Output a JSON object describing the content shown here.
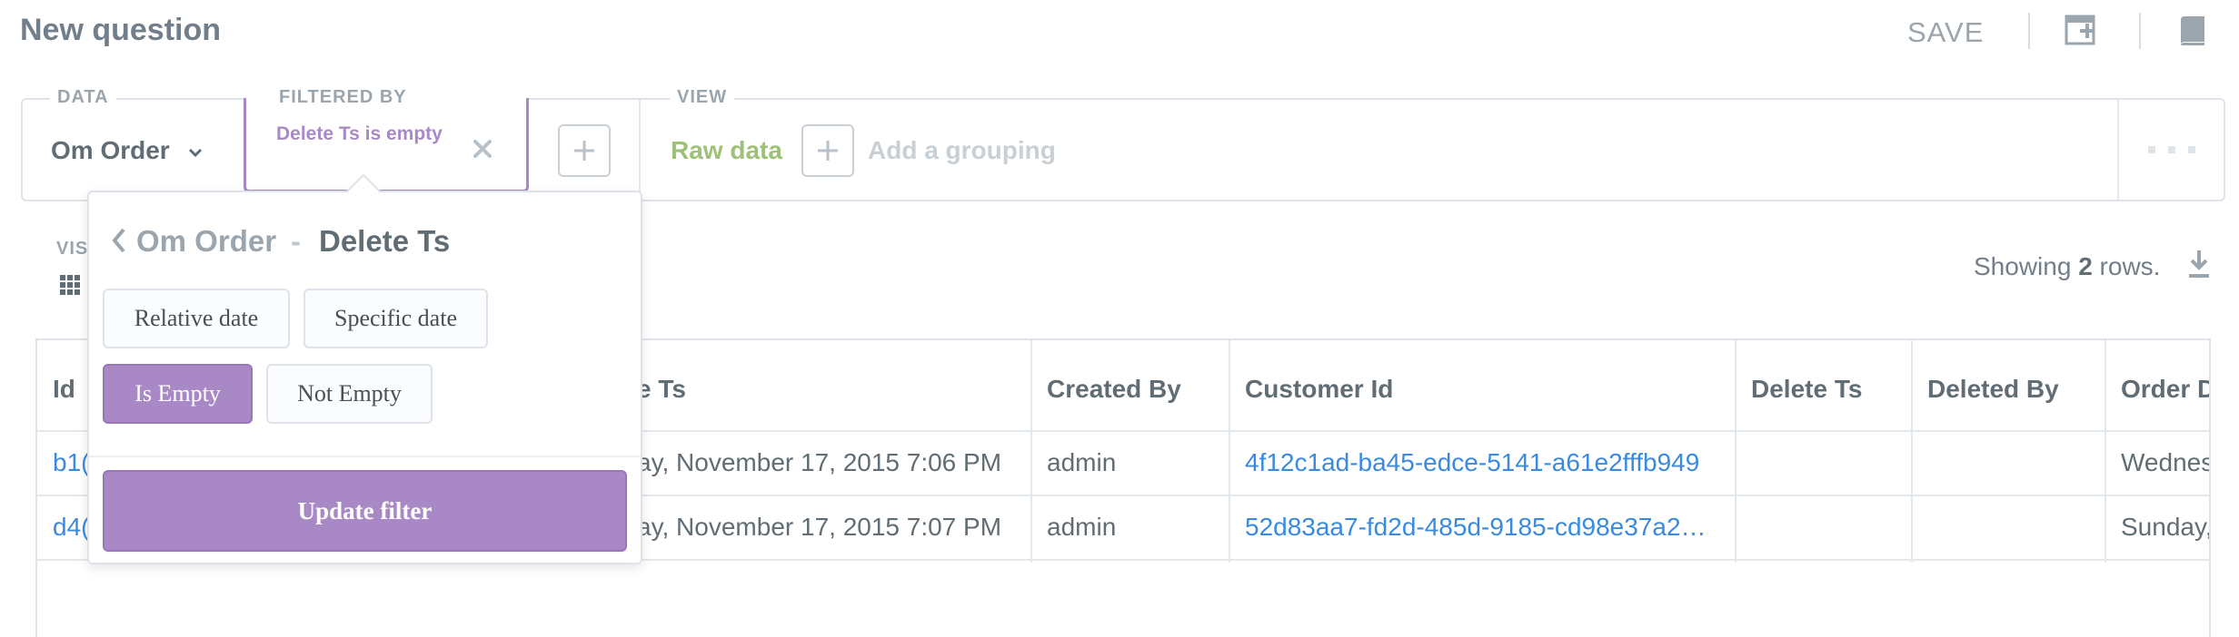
{
  "header": {
    "title": "New question",
    "save_label": "SAVE",
    "icons": [
      "add-to-dashboard-icon",
      "book-icon"
    ]
  },
  "query_builder": {
    "data_label": "DATA",
    "data_source": "Om Order",
    "filtered_by_label": "FILTERED BY",
    "filter_text": "Delete Ts is empty",
    "view_label": "VIEW",
    "view_value": "Raw data",
    "add_grouping": "Add a grouping"
  },
  "visualization": {
    "label": "VIS"
  },
  "results": {
    "showing_prefix": "Showing",
    "row_count": "2",
    "showing_suffix": "rows."
  },
  "table": {
    "headers": [
      "Id",
      "e Ts",
      "Created By",
      "Customer Id",
      "Delete Ts",
      "Deleted By",
      "Order D"
    ],
    "rows": [
      [
        "b1(",
        "ay, November 17, 2015 7:06 PM",
        "admin",
        "4f12c1ad-ba45-edce-5141-a61e2fffb949",
        "",
        "",
        "Wednes"
      ],
      [
        "d4(",
        "ay, November 17, 2015 7:07 PM",
        "admin",
        "52d83aa7-fd2d-485d-9185-cd98e37a2…",
        "",
        "",
        "Sunday,"
      ]
    ]
  },
  "popover": {
    "table_name": "Om Order",
    "dash": "-",
    "field_name": "Delete Ts",
    "options": [
      "Relative date",
      "Specific date",
      "Is Empty",
      "Not Empty"
    ],
    "selected_option": "Is Empty",
    "update_label": "Update filter"
  },
  "colors": {
    "accent_purple": "#a989c5",
    "raw_data_green": "#9cc177",
    "link_blue": "#3a8be0",
    "text_dark": "#616d75",
    "text_muted": "#9aa5ae",
    "border": "#dde3e8"
  }
}
